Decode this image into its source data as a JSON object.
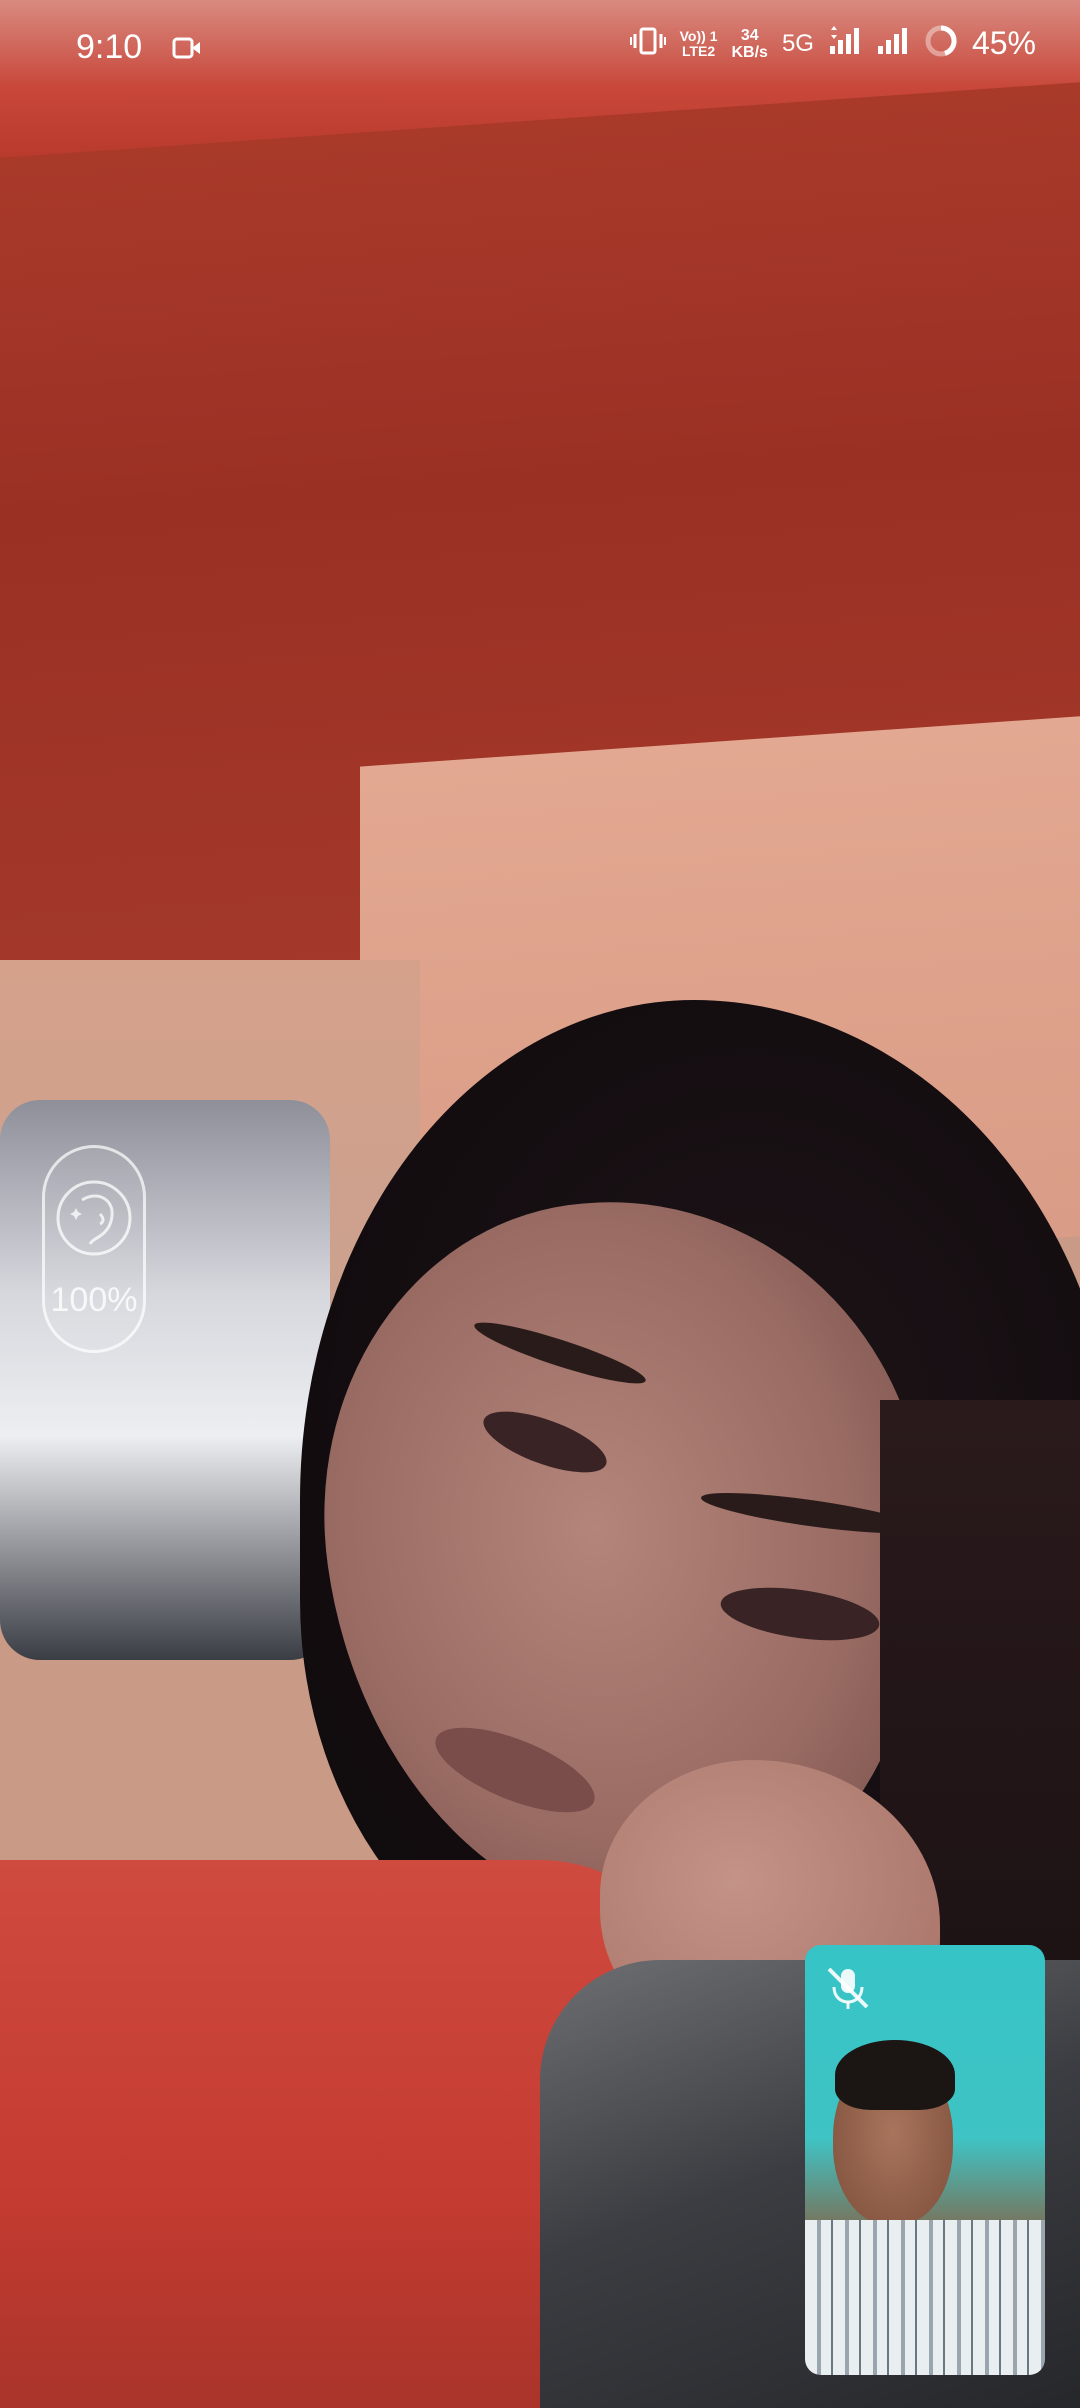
{
  "status_bar": {
    "time": "9:10",
    "volte_top": "Vo)) 1",
    "volte_bottom": "LTE2",
    "speed_value": "34",
    "speed_unit": "KB/s",
    "network_type": "5G",
    "battery_percent": "45%"
  },
  "beauty_filter": {
    "level": "100%",
    "icon": "face-beauty-icon"
  },
  "self_view": {
    "mic_state_icon": "mic-off-icon"
  },
  "colors": {
    "status_text": "#ffffff",
    "overlay_outline": "#ffffff"
  }
}
